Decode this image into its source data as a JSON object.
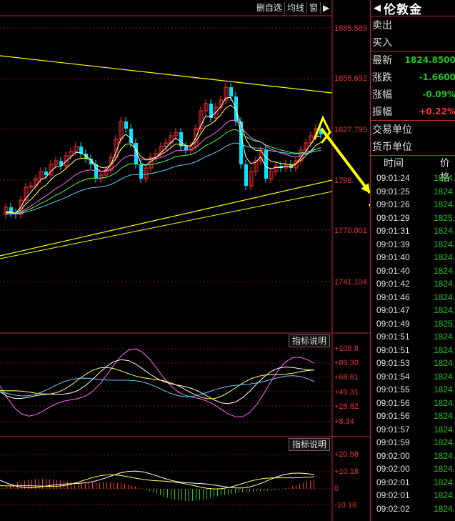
{
  "toolbar": {
    "delete_watch": "删自选",
    "avg_line": "均线",
    "window": "窗",
    "arrow": "▶"
  },
  "price_axis": [
    "1885.589",
    "1856.692",
    "1827.795",
    "1798.",
    "1770.001",
    "1741.104"
  ],
  "indicator1": {
    "button": "指标说明",
    "labels": [
      "+108.8",
      "+89.30",
      "+68.81",
      "+49.31",
      "+28.82",
      "+8.34"
    ]
  },
  "indicator2": {
    "button": "指标说明",
    "labels": [
      "+20.58",
      "+10.18",
      "0",
      "-10.18"
    ]
  },
  "colors": {
    "up": "#ff3030",
    "down": "#00e4ff",
    "accent_red": "#e8333a",
    "green": "#22c322",
    "annotation": "#ffff00"
  },
  "quote": {
    "title": "伦敦金",
    "back_icon": "◀",
    "sell_label": "卖出",
    "buy_label": "买入",
    "stats": [
      {
        "label": "最新",
        "value": "1824.8500",
        "color": "#22c322"
      },
      {
        "label": "涨跌",
        "value": "-1.6600",
        "color": "#22c322"
      },
      {
        "label": "涨幅",
        "value": "-0.09%",
        "color": "#22c322"
      },
      {
        "label": "振幅",
        "value": "+0.22%",
        "color": "#ff3030"
      }
    ],
    "trade_unit_label": "交易单位",
    "currency_unit_label": "货币单位",
    "ticks_header": {
      "time": "时间",
      "price": "价格"
    },
    "ticks": [
      {
        "t": "09:01:24",
        "p": "1824."
      },
      {
        "t": "09:01:25",
        "p": "1824."
      },
      {
        "t": "09:01:26",
        "p": "1824."
      },
      {
        "t": "09:01:29",
        "p": "1825."
      },
      {
        "t": "09:01:31",
        "p": "1824."
      },
      {
        "t": "09:01:39",
        "p": "1824."
      },
      {
        "t": "09:01:40",
        "p": "1824."
      },
      {
        "t": "09:01:40",
        "p": "1824."
      },
      {
        "t": "09:01:42",
        "p": "1824."
      },
      {
        "t": "09:01:46",
        "p": "1824."
      },
      {
        "t": "09:01:47",
        "p": "1824."
      },
      {
        "t": "09:01:49",
        "p": "1825."
      },
      {
        "t": "09:01:51",
        "p": "1824."
      },
      {
        "t": "09:01:51",
        "p": "1824."
      },
      {
        "t": "09:01:53",
        "p": "1824."
      },
      {
        "t": "09:01:54",
        "p": "1824."
      },
      {
        "t": "09:01:55",
        "p": "1824."
      },
      {
        "t": "09:01:56",
        "p": "1824."
      },
      {
        "t": "09:01:56",
        "p": "1824."
      },
      {
        "t": "09:01:57",
        "p": "1824."
      },
      {
        "t": "09:01:59",
        "p": "1824."
      },
      {
        "t": "09:02:00",
        "p": "1824."
      },
      {
        "t": "09:02:00",
        "p": "1824."
      },
      {
        "t": "09:02:01",
        "p": "1824."
      },
      {
        "t": "09:02:01",
        "p": "1824."
      },
      {
        "t": "09:02:02",
        "p": "1824."
      }
    ]
  }
}
